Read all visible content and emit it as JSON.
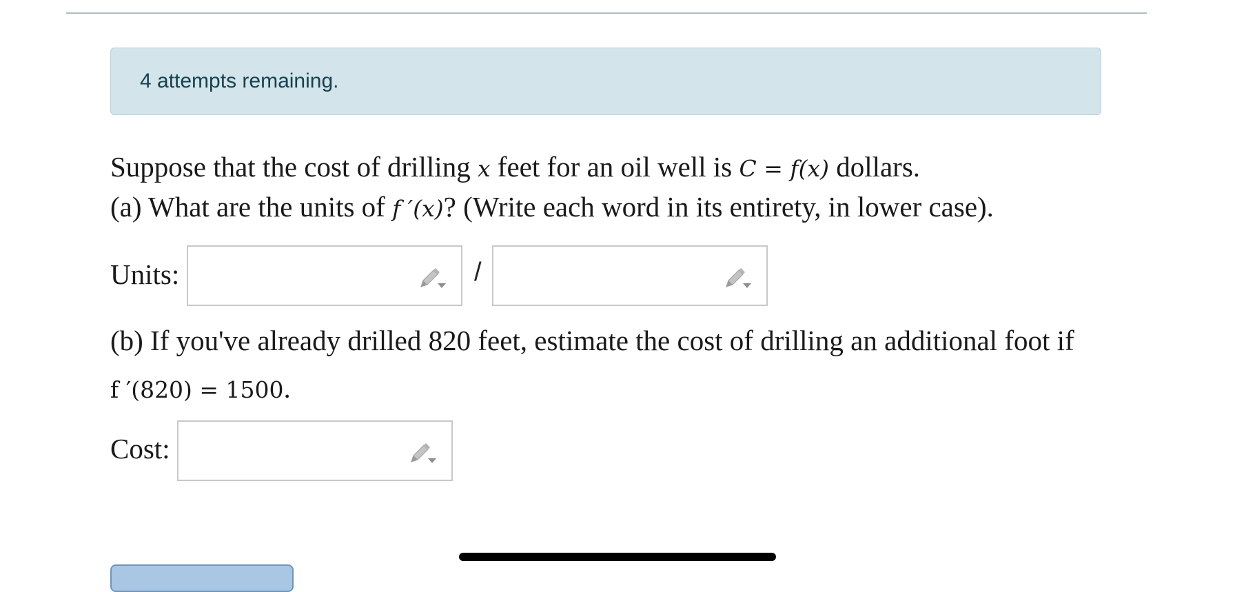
{
  "alert": {
    "text": "4 attempts remaining."
  },
  "question": {
    "line1": {
      "t1": "Suppose that the cost of drilling ",
      "x": "x",
      "t2": " feet for an oil well is ",
      "expr": "C = f(x)",
      "t3": " dollars."
    },
    "line2": {
      "t1": "(a) What are the units of ",
      "expr": "f ′(x)",
      "t2": "? (Write each word in its entirety, in lower case)."
    },
    "line3": "(b) If you've already drilled 820 feet, estimate the cost of drilling an additional foot if",
    "line4": {
      "expr": "f ′(820) = 1500",
      "t1": "."
    }
  },
  "units": {
    "label": "Units:",
    "separator": "/",
    "numerator_value": "",
    "denominator_value": ""
  },
  "cost": {
    "label": "Cost:",
    "value": ""
  },
  "icons": {
    "edit": "pencil-dropdown-icon"
  }
}
